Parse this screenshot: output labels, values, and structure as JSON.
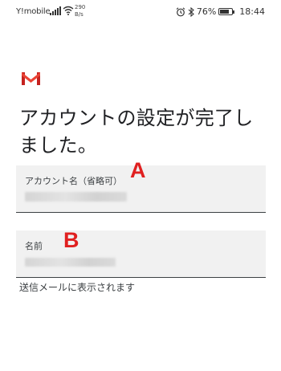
{
  "status_bar": {
    "carrier": "Y!mobile",
    "network_speed": "290\nB/s",
    "battery": "76%",
    "battery_level": 0.76,
    "time": "18:44"
  },
  "setup": {
    "logo_icon": "gmail-logo-icon",
    "title": "アカウントの設定が完了しました。"
  },
  "account_name_field": {
    "label": "アカウント名（省略可）",
    "marker": "A"
  },
  "name_field": {
    "label": "名前",
    "marker": "B",
    "helper": "送信メールに表示されます"
  },
  "colors": {
    "marker": "#e02020",
    "gmail_red": "#d93025",
    "field_bg": "#f1f1f1"
  }
}
